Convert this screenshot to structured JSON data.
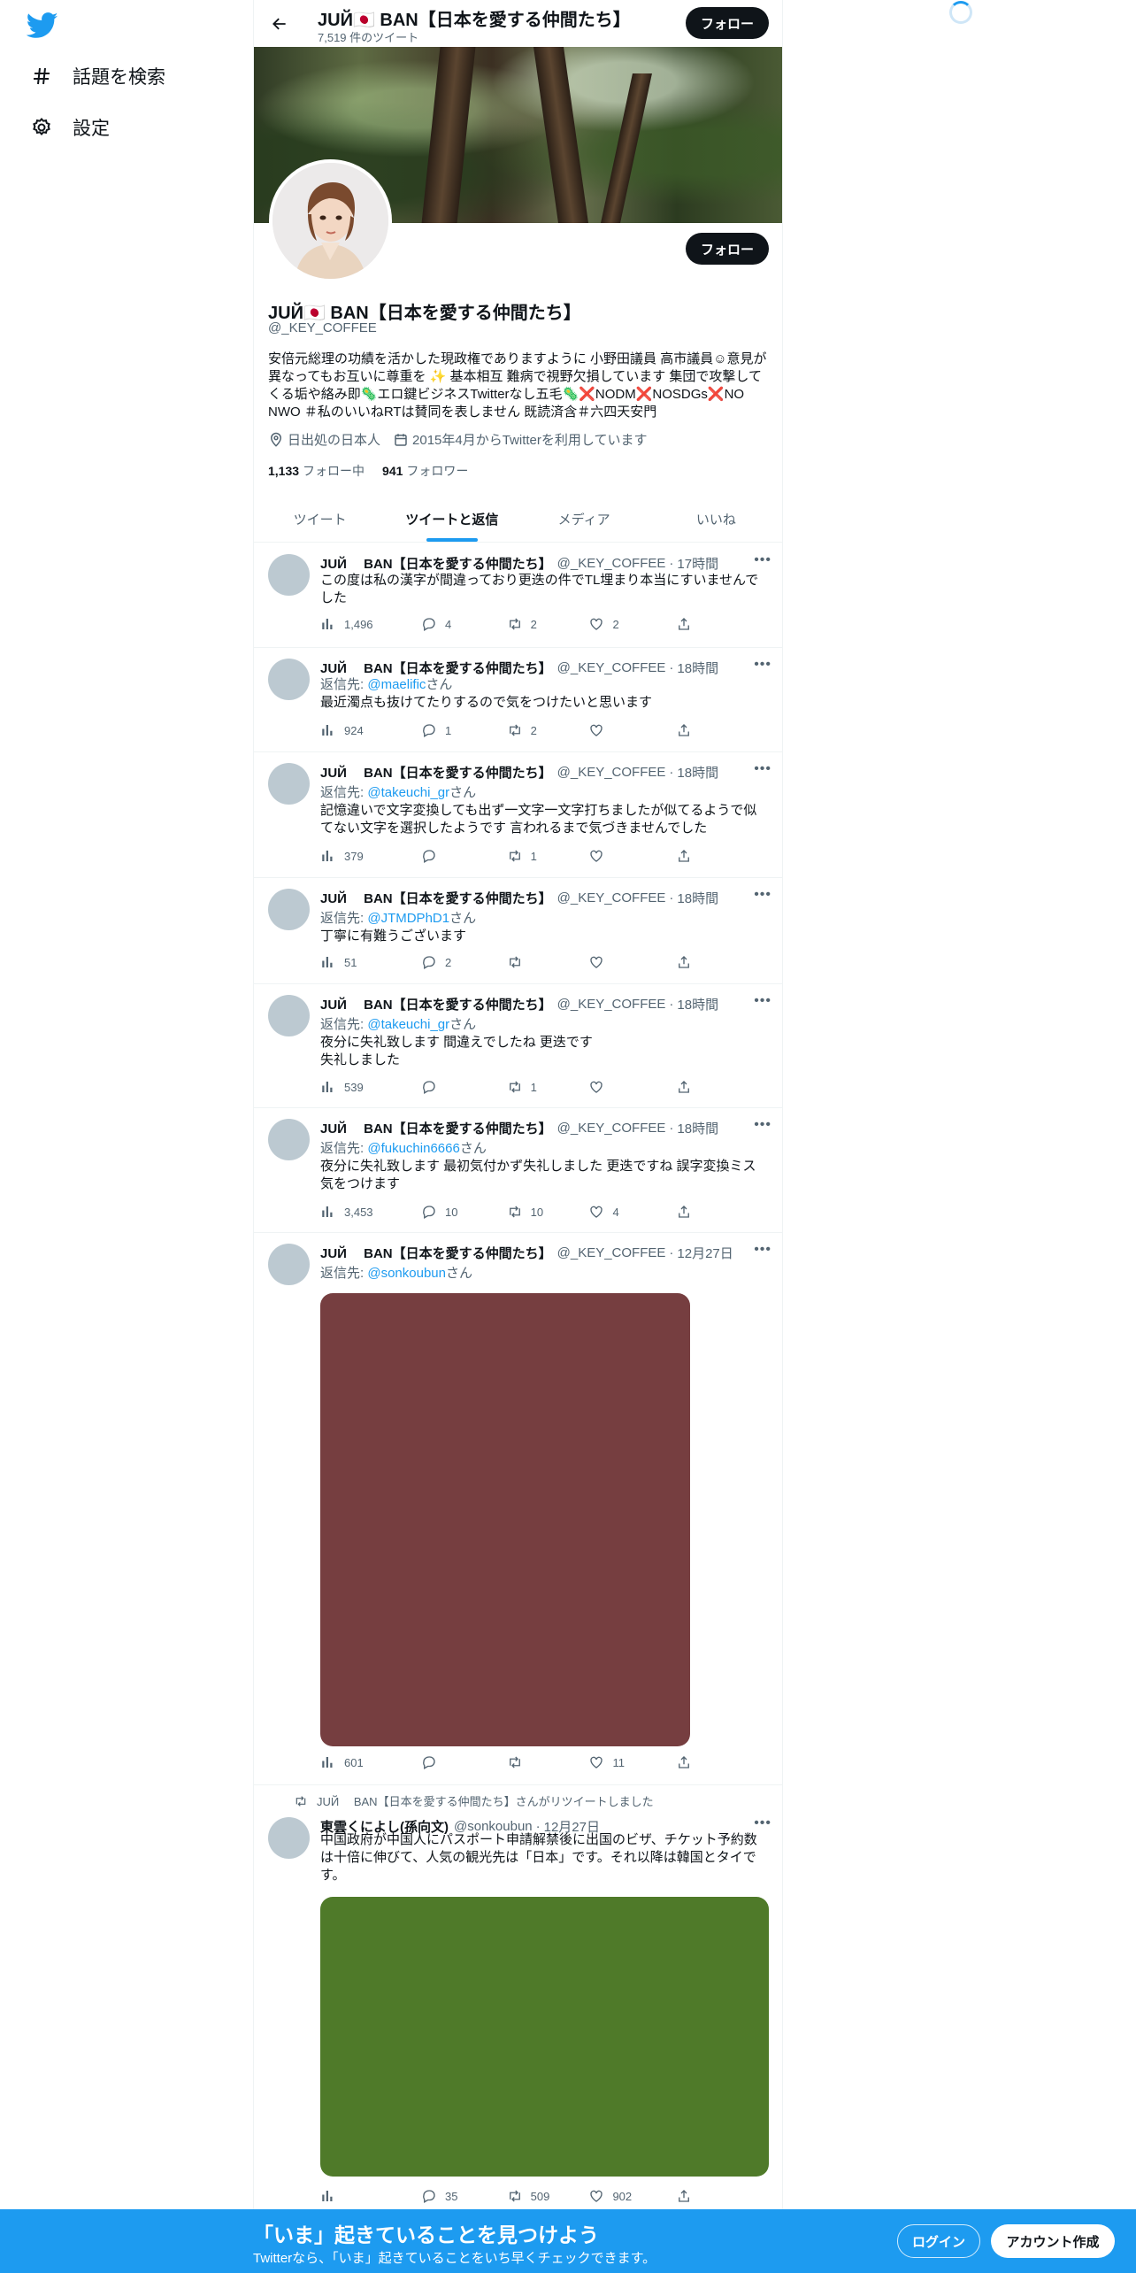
{
  "nav": {
    "explore_label": "話題を検索",
    "settings_label": "設定"
  },
  "header": {
    "title": "JUЙ🇯🇵 BAN【日本を愛する仲間たち】",
    "tweet_count": "7,519 件のツイート",
    "follow_label": "フォロー"
  },
  "profile": {
    "name": "JUЙ🇯🇵 BAN【日本を愛する仲間たち】",
    "handle": "@_KEY_COFFEE",
    "follow_label": "フォロー",
    "bio": "安倍元総理の功績を活かした現政権でありますように 小野田議員 高市議員☺意見が異なってもお互いに尊重を ✨ 基本相互 難病で視野欠損しています 集団で攻撃してくる垢や絡み即🦠エロ鍵ビジネスTwitterなし五毛🦠❌NODM❌NOSDGs❌NO NWO ＃私のいいねRTは賛同を表しません 既読済含＃六四天安門",
    "location": "日出処の日本人",
    "joined": "2015年4月からTwitterを利用しています",
    "following_count": "1,133",
    "following_label": "フォロー中",
    "followers_count": "941",
    "followers_label": "フォロワー"
  },
  "tabs": [
    "ツイート",
    "ツイートと返信",
    "メディア",
    "いいね"
  ],
  "tweets": [
    {
      "name": "JUЙ　 BAN【日本を愛する仲間たち】",
      "handle": "@_KEY_COFFEE",
      "time": "17時間",
      "text": "この度は私の漢字が間違っており更迭の件でTL埋まり本当にすいませんでした",
      "views": "1,496",
      "replies": "4",
      "retweets": "2",
      "likes": "2"
    },
    {
      "name": "JUЙ　 BAN【日本を愛する仲間たち】",
      "handle": "@_KEY_COFFEE",
      "time": "18時間",
      "reply_prefix": "返信先: ",
      "reply_user": "@maelific",
      "reply_suffix": "さん",
      "text": "最近濁点も抜けてたりするので気をつけたいと思います",
      "views": "924",
      "replies": "1",
      "retweets": "2",
      "likes": ""
    },
    {
      "name": "JUЙ　 BAN【日本を愛する仲間たち】",
      "handle": "@_KEY_COFFEE",
      "time": "18時間",
      "reply_prefix": "返信先: ",
      "reply_user": "@takeuchi_gr",
      "reply_suffix": "さん",
      "text": "記憶違いで文字変換しても出ず一文字一文字打ちましたが似てるようで似てない文字を選択したようです 言われるまで気づきませんでした",
      "views": "379",
      "replies": "",
      "retweets": "1",
      "likes": ""
    },
    {
      "name": "JUЙ　 BAN【日本を愛する仲間たち】",
      "handle": "@_KEY_COFFEE",
      "time": "18時間",
      "reply_prefix": "返信先: ",
      "reply_user": "@JTMDPhD1",
      "reply_suffix": "さん",
      "text": "丁寧に有難うございます",
      "views": "51",
      "replies": "2",
      "retweets": "",
      "likes": ""
    },
    {
      "name": "JUЙ　 BAN【日本を愛する仲間たち】",
      "handle": "@_KEY_COFFEE",
      "time": "18時間",
      "reply_prefix": "返信先: ",
      "reply_user": "@takeuchi_gr",
      "reply_suffix": "さん",
      "text": "夜分に失礼致します 間違えでしたね 更迭です\n失礼しました",
      "views": "539",
      "replies": "",
      "retweets": "1",
      "likes": ""
    },
    {
      "name": "JUЙ　 BAN【日本を愛する仲間たち】",
      "handle": "@_KEY_COFFEE",
      "time": "18時間",
      "reply_prefix": "返信先: ",
      "reply_user": "@fukuchin6666",
      "reply_suffix": "さん",
      "text": "夜分に失礼致します 最初気付かず失礼しました 更迭ですね 誤字変換ミス気をつけます",
      "views": "3,453",
      "replies": "10",
      "retweets": "10",
      "likes": "4"
    },
    {
      "name": "JUЙ　 BAN【日本を愛する仲間たち】",
      "handle": "@_KEY_COFFEE",
      "time": "12月27日",
      "reply_prefix": "返信先: ",
      "reply_user": "@sonkoubun",
      "reply_suffix": "さん",
      "text": "",
      "media_color": "#763e40",
      "views": "601",
      "replies": "",
      "retweets": "",
      "likes": "11"
    },
    {
      "retweet_note": "JUЙ　 BAN【日本を愛する仲間たち】さんがリツイートしました",
      "name": "東雲くによし(孫向文)",
      "handle": "@sonkoubun",
      "time": "12月27日",
      "text": "中国政府が中国人にパスポート申請解禁後に出国のビザ、チケット予約数は十倍に伸びて、人気の観光先は「日本」です。それ以降は韓国とタイです。",
      "media_color": "#4f7a29",
      "views": "",
      "replies": "35",
      "retweets": "509",
      "likes": "902"
    }
  ],
  "bottom_bar": {
    "title": "「いま」起きていることを見つけよう",
    "subtitle": "Twitterなら、「いま」起きていることをいち早くチェックできます。",
    "login_label": "ログイン",
    "signup_label": "アカウント作成"
  },
  "colors": {
    "accent": "#1d9bf0",
    "text": "#0f1419",
    "secondary": "#536471",
    "divider": "#eff3f4"
  }
}
